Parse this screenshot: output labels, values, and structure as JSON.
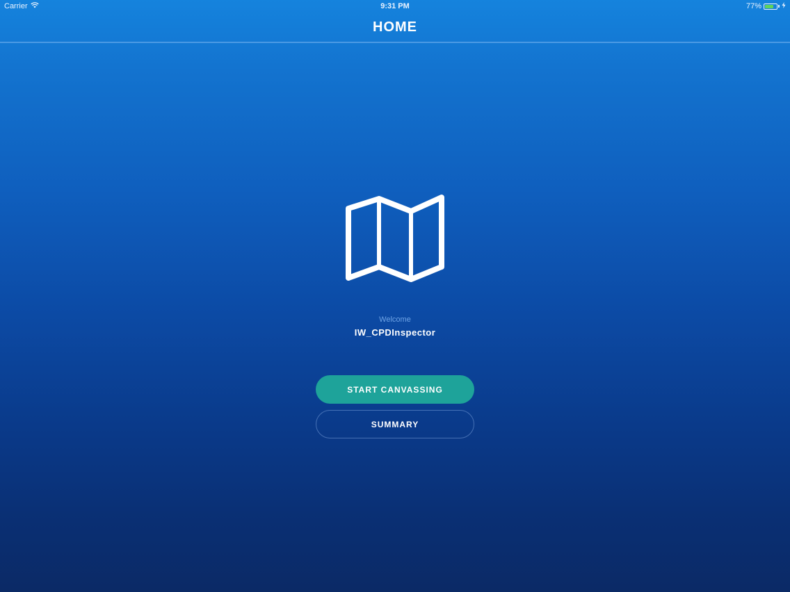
{
  "status_bar": {
    "carrier": "Carrier",
    "time": "9:31 PM",
    "battery_percent": "77%",
    "battery_level": 0.77,
    "icons": [
      "wifi-icon",
      "battery-icon",
      "charging-icon"
    ]
  },
  "nav": {
    "title": "HOME"
  },
  "hero": {
    "icon": "map-icon"
  },
  "greeting": {
    "welcome_label": "Welcome",
    "username": "IW_CPDInspector"
  },
  "actions": {
    "start_label": "START CANVASSING",
    "summary_label": "SUMMARY"
  },
  "colors": {
    "primary_button": "#1ea39a",
    "welcome_text": "#6fa4e6",
    "battery_fill": "#5fd35c"
  }
}
